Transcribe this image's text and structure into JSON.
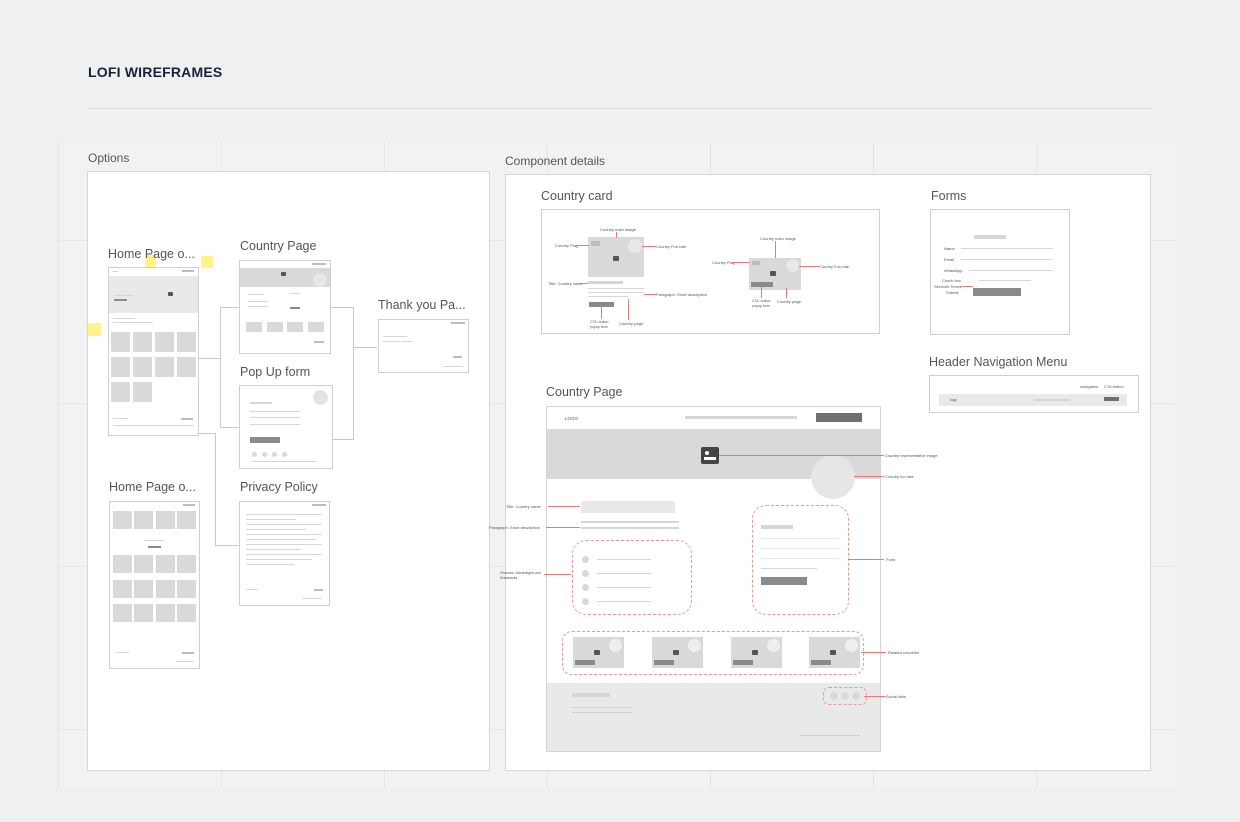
{
  "page": {
    "title": "LOFI WIREFRAMES"
  },
  "options": {
    "label": "Options",
    "frames": {
      "home1": "Home Page o...",
      "country": "Country Page",
      "thankyou": "Thank you Pa...",
      "popup": "Pop Up form",
      "home2": "Home Page o...",
      "privacy": "Privacy Policy"
    }
  },
  "components": {
    "label": "Component details",
    "country_card": {
      "title": "Country card",
      "notes": {
        "main_image": "Country main image",
        "flag": "Country Flag",
        "fun_rate": "Country Fun rate",
        "title": "Title: Country name",
        "paragraph": "Paragraph: Short description",
        "cta": "CTA: button popup form",
        "page": "Country page",
        "main_image2": "Country main image",
        "flag2": "Country Flag",
        "fun_rate2": "Country Fun rate",
        "cta2": "CTA: button popup form",
        "page2": "Country page"
      }
    },
    "forms": {
      "title": "Forms",
      "fields": [
        "Name",
        "Email",
        "WhatsApp",
        "Check box",
        "Services Terms",
        "Submit"
      ]
    },
    "header_nav": {
      "title": "Header Navigation Menu",
      "notes": [
        "navigation",
        "CTA button"
      ],
      "logo": "logo"
    },
    "country_page": {
      "title": "Country Page",
      "logo": "LOGO",
      "notes": {
        "image": "Country representative image",
        "fun_rate": "Country fun rate",
        "title": "Title: Country name",
        "paragraph": "Paragraph: Short description",
        "features": "Features, Advantages and Drawbacks",
        "form": "Form",
        "related": "Related countries",
        "social": "Social links"
      }
    }
  }
}
